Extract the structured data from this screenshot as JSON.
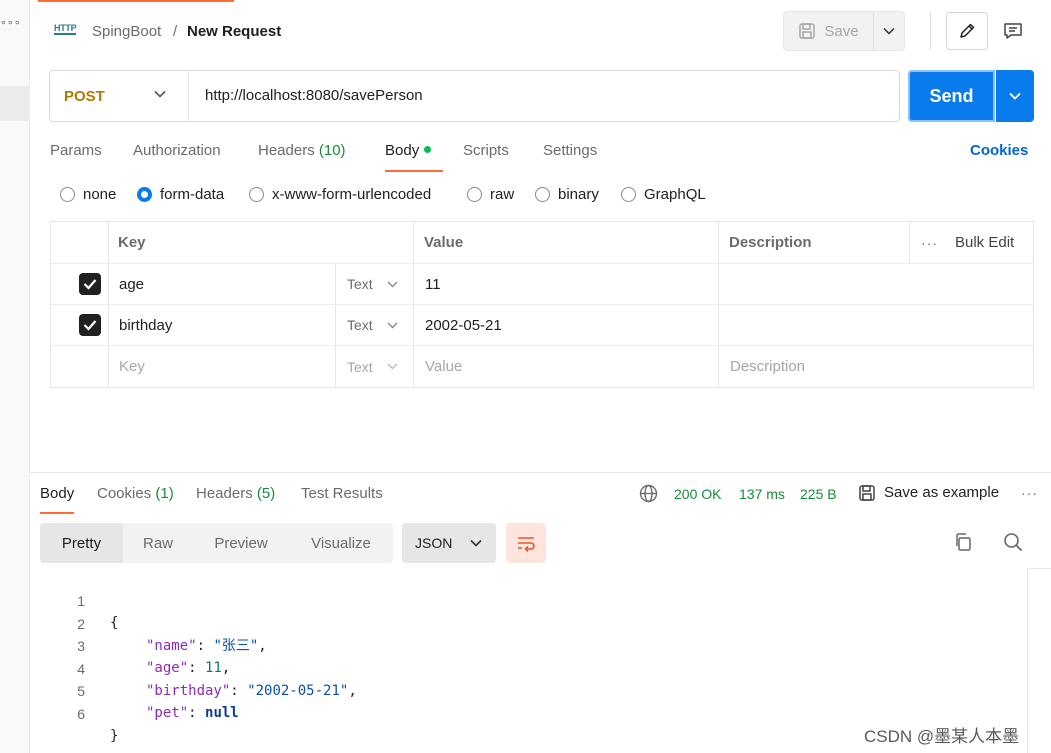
{
  "sidebar": {
    "more_glyph": "∘∘∘"
  },
  "header": {
    "icon_text": "HTTP",
    "collection": "SpingBoot",
    "separator": "/",
    "request_name": "New Request",
    "save_label": "Save"
  },
  "request": {
    "method": "POST",
    "url": "http://localhost:8080/savePerson",
    "send_label": "Send",
    "tabs": [
      {
        "label": "Params"
      },
      {
        "label": "Authorization"
      },
      {
        "label": "Headers",
        "count": "(10)"
      },
      {
        "label": "Body",
        "active": true
      },
      {
        "label": "Scripts"
      },
      {
        "label": "Settings"
      }
    ],
    "cookies_label": "Cookies",
    "body_types": [
      {
        "label": "none",
        "selected": false
      },
      {
        "label": "form-data",
        "selected": true
      },
      {
        "label": "x-www-form-urlencoded",
        "selected": false
      },
      {
        "label": "raw",
        "selected": false
      },
      {
        "label": "binary",
        "selected": false
      },
      {
        "label": "GraphQL",
        "selected": false
      }
    ],
    "form_table": {
      "headers": {
        "key": "Key",
        "value": "Value",
        "description": "Description",
        "bulk_edit": "Bulk Edit",
        "more": "···"
      },
      "rows": [
        {
          "checked": true,
          "key": "age",
          "type": "Text",
          "value": "11",
          "description": ""
        },
        {
          "checked": true,
          "key": "birthday",
          "type": "Text",
          "value": "2002-05-21",
          "description": ""
        }
      ],
      "new_row": {
        "key_placeholder": "Key",
        "type": "Text",
        "value_placeholder": "Value",
        "description_placeholder": "Description"
      }
    }
  },
  "response": {
    "tabs": [
      {
        "label": "Body",
        "active": true
      },
      {
        "label": "Cookies",
        "count": "(1)"
      },
      {
        "label": "Headers",
        "count": "(5)"
      },
      {
        "label": "Test Results"
      }
    ],
    "status": "200 OK",
    "time": "137 ms",
    "size": "225 B",
    "save_example_label": "Save as example",
    "more": "···",
    "formats": [
      "Pretty",
      "Raw",
      "Preview",
      "Visualize"
    ],
    "active_format": "Pretty",
    "language": "JSON",
    "lines": [
      {
        "n": "1",
        "text": "{"
      },
      {
        "n": "2",
        "key": "\"name\"",
        "value": "\"张三\"",
        "value_type": "string",
        "trail": ","
      },
      {
        "n": "3",
        "key": "\"age\"",
        "value": "11",
        "value_type": "number",
        "trail": ","
      },
      {
        "n": "4",
        "key": "\"birthday\"",
        "value": "\"2002-05-21\"",
        "value_type": "string",
        "trail": ","
      },
      {
        "n": "5",
        "key": "\"pet\"",
        "value": "null",
        "value_type": "keyword",
        "trail": ""
      },
      {
        "n": "6",
        "text": "}"
      }
    ]
  },
  "watermark": "CSDN @墨某人本墨",
  "colors": {
    "accent": "#ff6c37",
    "send": "#097bed",
    "method_post": "#ad7a03",
    "success": "#1a8a3d",
    "link": "#0265d2"
  }
}
